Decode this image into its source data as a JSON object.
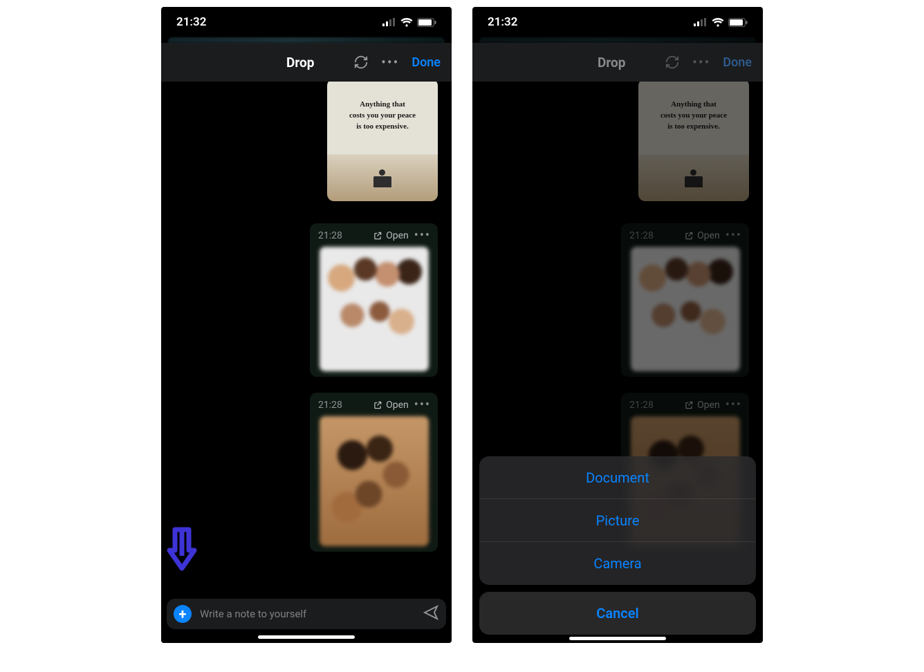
{
  "status": {
    "time": "21:32"
  },
  "nav": {
    "title": "Drop",
    "done": "Done"
  },
  "quote": {
    "line1": "Anything that",
    "line2": "costs you your peace",
    "line3": "is too expensive."
  },
  "cards": [
    {
      "time": "21:28",
      "open": "Open"
    },
    {
      "time": "21:28",
      "open": "Open"
    }
  ],
  "input": {
    "placeholder": "Write a note to yourself"
  },
  "sheet": {
    "items": [
      "Document",
      "Picture",
      "Camera"
    ],
    "cancel": "Cancel"
  }
}
